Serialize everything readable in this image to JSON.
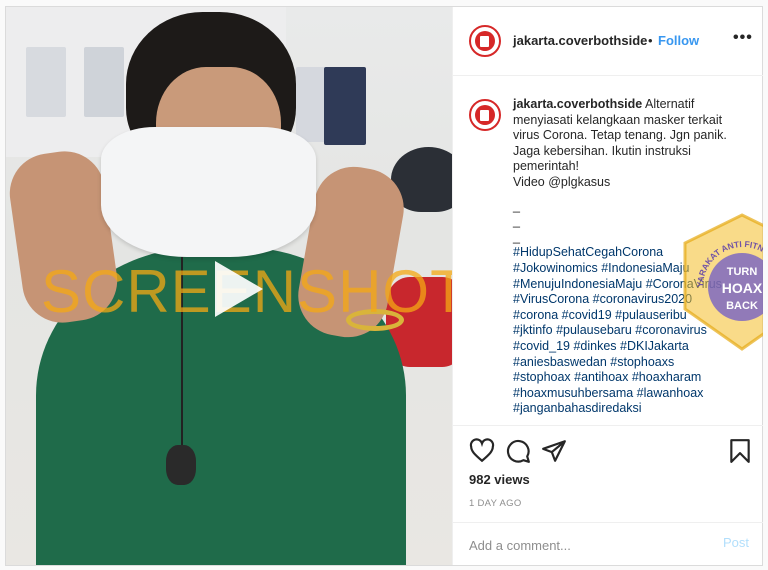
{
  "header": {
    "username": "jakarta.coverbothside",
    "separator": "•",
    "follow_label": "Follow",
    "more_label": "•••"
  },
  "media": {
    "watermark": "SCREENSHOT BY"
  },
  "stamp": {
    "ring_text": "MASYARAKAT ANTI FITNAH INDONESIA",
    "top_text": "TURN",
    "bottom_text": "BACK",
    "mid_text": "HOAX"
  },
  "caption": {
    "username": "jakarta.coverbothside",
    "lines": [
      "Alternatif menyiasati kelangkaan masker terkait virus Corona. Tetap tenang. Jgn panik. Jaga kebersihan. Ikutin instruksi pemerintah!",
      "Video @plgkasus"
    ],
    "dashes": [
      "_",
      "_",
      "_"
    ],
    "hashtags": [
      "#HidupSehatCegahCorona",
      "#Jokowinomics #IndonesiaMaju",
      "#MenujuIndonesiaMaju #CoronaVirus",
      "#VirusCorona #coronavirus2020",
      "#corona #covid19 #pulauseribu",
      "#jktinfo #pulausebaru #coronavirus",
      "#covid_19 #dinkes #DKIJakarta",
      "#aniesbaswedan #stophoaxs",
      "#stophoax #antihoax #hoaxharam",
      "#hoaxmusuhbersama #lawanhoax",
      "#janganbahasdiredaksi"
    ]
  },
  "footer": {
    "views": "982 views",
    "time_ago": "1 DAY AGO",
    "comment_placeholder": "Add a comment...",
    "post_label": "Post"
  }
}
